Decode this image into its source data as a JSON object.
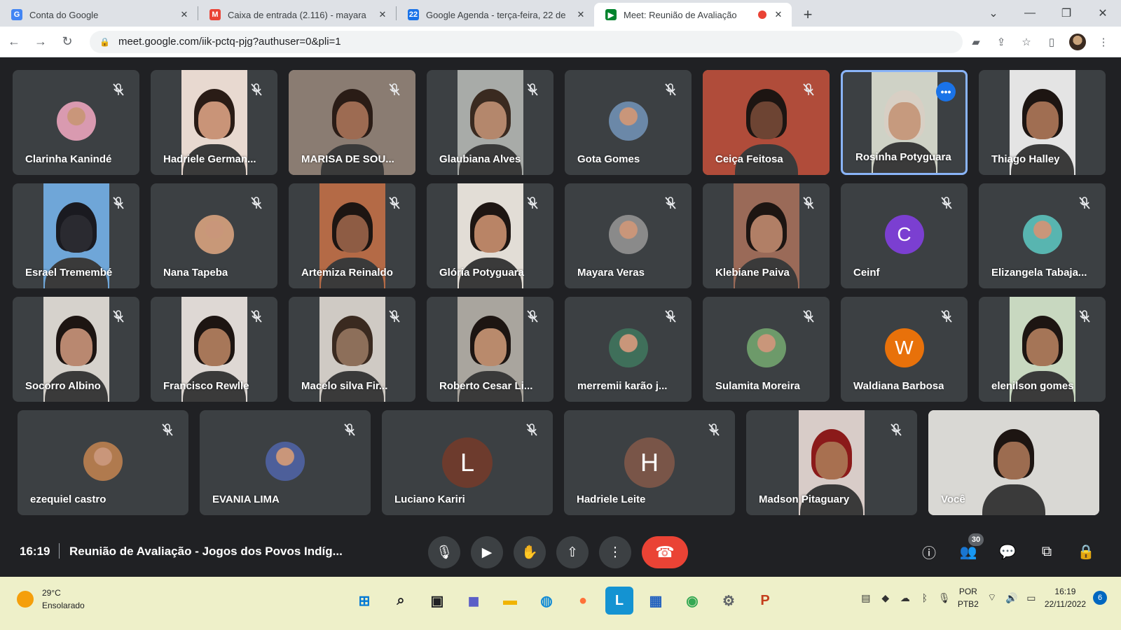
{
  "browser": {
    "tabs": [
      {
        "title": "Conta do Google",
        "favicon": "G",
        "favicon_color": "#4285f4",
        "active": false
      },
      {
        "title": "Caixa de entrada (2.116) - mayara",
        "favicon": "M",
        "favicon_color": "#ea4335",
        "active": false
      },
      {
        "title": "Google Agenda - terça-feira, 22 de",
        "favicon": "22",
        "favicon_color": "#1a73e8",
        "active": false
      },
      {
        "title": "Meet: Reunião de Avaliação",
        "favicon": "▶",
        "favicon_color": "#00832d",
        "active": true
      }
    ],
    "url": "meet.google.com/iik-pctq-pjg?authuser=0&pli=1"
  },
  "participants": [
    {
      "name": "Clarinha Kanindé",
      "kind": "photo",
      "color": "#d99ab0",
      "muted": true
    },
    {
      "name": "Hadriele German...",
      "kind": "video",
      "color": "#e8d9d0",
      "skin": "#c99478",
      "hair": "#2a1c16",
      "muted": true
    },
    {
      "name": "MARISA DE SOU...",
      "kind": "video-wide",
      "color": "#8a7c72",
      "skin": "#9d6b52",
      "hair": "#2a1c16",
      "muted": true,
      "accent": "#8ab4f8"
    },
    {
      "name": "Glaubiana Alves",
      "kind": "video",
      "color": "#a8aba8",
      "skin": "#b4876c",
      "hair": "#3a2a20",
      "muted": true
    },
    {
      "name": "Gota Gomes",
      "kind": "photo",
      "color": "#6b88a8",
      "muted": true
    },
    {
      "name": "Ceiça Feitosa",
      "kind": "video-wide",
      "color": "#b04c3a",
      "skin": "#6d4433",
      "hair": "#1d1512",
      "muted": true
    },
    {
      "name": "Rosinha Potyguara",
      "kind": "video",
      "color": "#cfd2c6",
      "skin": "#c69a7e",
      "hair": "#d8cfc4",
      "muted": false,
      "active": true
    },
    {
      "name": "Thiago Halley",
      "kind": "video",
      "color": "#e4e4e4",
      "skin": "#a06e52",
      "hair": "#1d1512",
      "muted": false
    },
    {
      "name": "Esrael Tremembé",
      "kind": "video",
      "color": "#6fa6d8",
      "skin": "#2a2a30",
      "hair": "#1a1a20",
      "muted": true
    },
    {
      "name": "Nana Tapeba",
      "kind": "photo",
      "color": "#c89878",
      "muted": true
    },
    {
      "name": "Artemiza Reinaldo",
      "kind": "video",
      "color": "#b46a46",
      "skin": "#8e5c44",
      "hair": "#1d1512",
      "muted": true
    },
    {
      "name": "Glória Potyguara",
      "kind": "video",
      "color": "#e2ddd6",
      "skin": "#b98466",
      "hair": "#1d1512",
      "muted": true
    },
    {
      "name": "Mayara Veras",
      "kind": "photo",
      "color": "#8a8a8a",
      "muted": true
    },
    {
      "name": "Klebiane Paiva",
      "kind": "video",
      "color": "#9a6a58",
      "skin": "#b17f66",
      "hair": "#1d1512",
      "muted": true
    },
    {
      "name": "Ceinf",
      "kind": "letter",
      "letter": "C",
      "color": "#7b3fd1",
      "muted": true
    },
    {
      "name": "Elizangela Tabaja...",
      "kind": "photo",
      "color": "#58b5b0",
      "muted": true
    },
    {
      "name": "Socorro Albino",
      "kind": "video",
      "color": "#d6d2cc",
      "skin": "#b98870",
      "hair": "#1d1512",
      "muted": true
    },
    {
      "name": "Francisco Rewlle",
      "kind": "video",
      "color": "#ded8d4",
      "skin": "#a77759",
      "hair": "#1d1512",
      "muted": true
    },
    {
      "name": "Macelo silva Fir...",
      "kind": "video",
      "color": "#cfcac4",
      "skin": "#8d6f5a",
      "hair": "#3a2a20",
      "muted": true
    },
    {
      "name": "Roberto Cesar Li...",
      "kind": "video",
      "color": "#a9a59e",
      "skin": "#b98a6c",
      "hair": "#1d1512",
      "muted": true
    },
    {
      "name": "merremii karão j...",
      "kind": "photo",
      "color": "#3f6f5a",
      "muted": true
    },
    {
      "name": "Sulamita Moreira",
      "kind": "photo",
      "color": "#6d9a6a",
      "muted": true
    },
    {
      "name": "Waldiana Barbosa",
      "kind": "letter",
      "letter": "W",
      "color": "#e8710a",
      "muted": true
    },
    {
      "name": "elenilson gomes",
      "kind": "video",
      "color": "#c8d8c0",
      "skin": "#a57557",
      "hair": "#1d1512",
      "muted": true
    },
    {
      "name": "ezequiel castro",
      "kind": "photo",
      "color": "#b07a4e",
      "muted": true
    },
    {
      "name": "EVANIA LIMA",
      "kind": "photo",
      "color": "#4d5f9a",
      "muted": true
    },
    {
      "name": "Luciano Kariri",
      "kind": "letter",
      "letter": "L",
      "color": "#6d3b2d",
      "muted": true
    },
    {
      "name": "Hadriele Leite",
      "kind": "letter",
      "letter": "H",
      "color": "#795548",
      "muted": true
    },
    {
      "name": "Madson Pitaguary",
      "kind": "video",
      "color": "#d8ccc8",
      "skin": "#a87050",
      "hair": "#8b1a1a",
      "muted": true
    },
    {
      "name": "Você",
      "kind": "video-wide",
      "color": "#d9d8d4",
      "skin": "#9c6c50",
      "hair": "#1d1512",
      "muted": false
    }
  ],
  "meeting": {
    "time": "16:19",
    "title": "Reunião de Avaliação - Jogos dos Povos Indíg...",
    "participant_count": "30"
  },
  "taskbar": {
    "temperature": "29°C",
    "condition": "Ensolarado",
    "lang1": "POR",
    "lang2": "PTB2",
    "clock_time": "16:19",
    "clock_date": "22/11/2022",
    "notifications": "6"
  }
}
